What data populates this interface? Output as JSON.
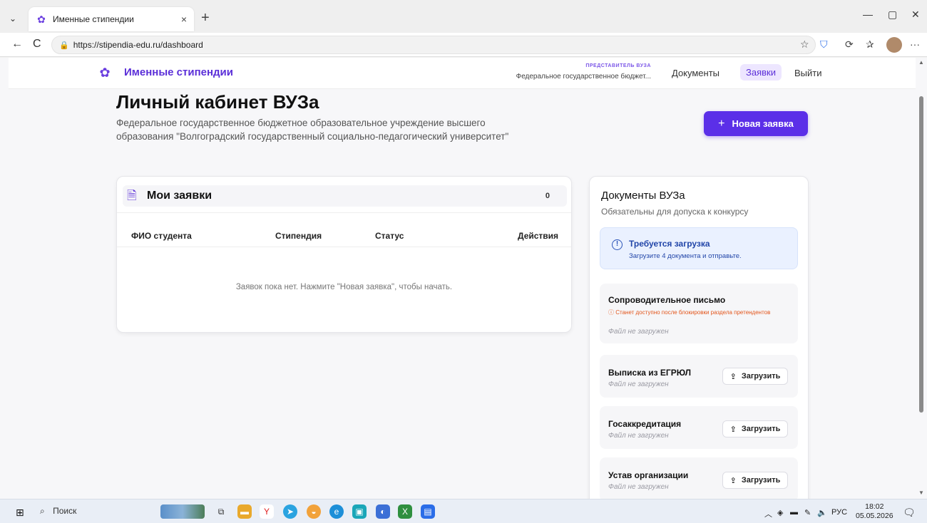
{
  "browser": {
    "tab_title": "Именные стипендии",
    "tab_close": "×",
    "new_tab": "+",
    "url": "https://stipendia-edu.ru/dashboard",
    "win_min": "—",
    "win_max": "▢",
    "win_close": "✕",
    "back": "←",
    "reload": "C",
    "more": "···"
  },
  "header": {
    "logo_text": "Именные стипендии",
    "rep_label": "ПРЕДСТАВИТЕЛЬ ВУЗА",
    "rep_org": "Федеральное государственное бюджет...",
    "nav": [
      "Документы",
      "Заявки",
      "Выйти"
    ]
  },
  "page": {
    "title": "Личный кабинет ВУЗа",
    "subtitle": "Федеральное государственное бюджетное образовательное учреждение высшего образования \"Волгоградский государственный социально-педагогический университет\"",
    "new_button": "Новая заявка",
    "new_button_icon": "+"
  },
  "applications": {
    "title": "Мои заявки",
    "count": "0",
    "columns": [
      "ФИО студента",
      "Стипендия",
      "Статус",
      "Действия"
    ],
    "empty_text": "Заявок пока нет. Нажмите \"Новая заявка\", чтобы начать."
  },
  "documents": {
    "title": "Документы ВУЗа",
    "subtitle": "Обязательны для допуска к конкурсу",
    "alert_title": "Требуется загрузка",
    "alert_text": "Загрузите 4 документа и отправьте.",
    "alert_icon": "!",
    "upload_label": "Загрузить",
    "upload_icon": "⇪",
    "items": [
      {
        "name": "Сопроводительное письмо",
        "warning": "ⓘ Станет доступно после блокировки раздела претендентов",
        "status": "Файл не загружен"
      },
      {
        "name": "Выписка из ЕГРЮЛ",
        "status": "Файл не загружен"
      },
      {
        "name": "Госаккредитация",
        "status": "Файл не загружен"
      },
      {
        "name": "Устав организации",
        "status": "Файл не загружен"
      }
    ]
  },
  "taskbar": {
    "search": "Поиск",
    "lang": "РУС",
    "time": "18:02",
    "date": "05.05.2026"
  },
  "colors": {
    "brand": "#5b2fe8",
    "alert_bg": "#eaf1ff",
    "warning": "#e3561c"
  }
}
